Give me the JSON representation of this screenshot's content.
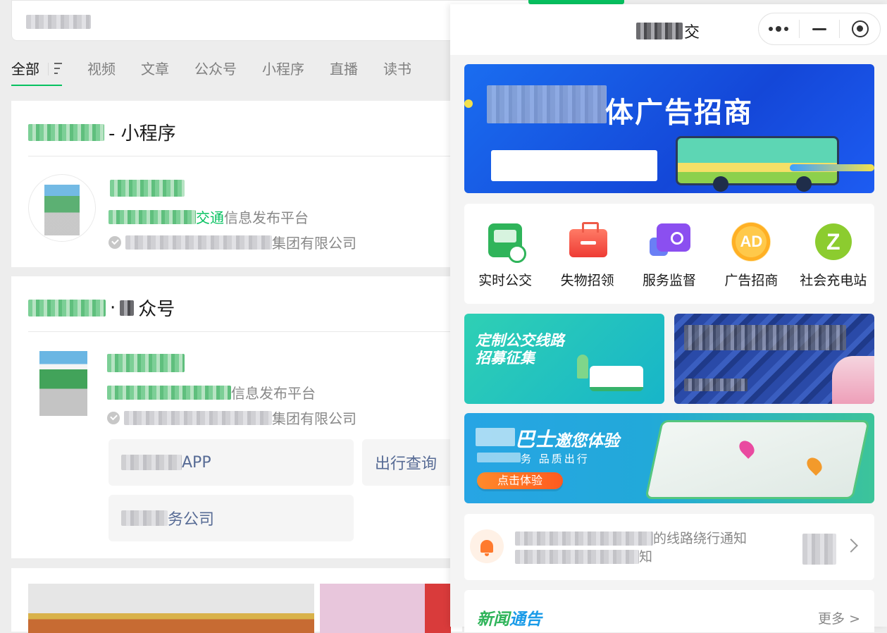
{
  "search": {
    "tabs": [
      "视频",
      "文章",
      "公众号",
      "小程序",
      "直播",
      "读书"
    ],
    "active_tab": "全部"
  },
  "miniprogram_card": {
    "title_suffix": "- 小程序",
    "desc_hl": "交通",
    "desc_rest": "信息发布平台",
    "company_suffix": "集团有限公司"
  },
  "official_account_card": {
    "title_suffix": "众号",
    "desc_rest": "信息发布平台",
    "company_suffix": "集团有限公司",
    "services": [
      {
        "label": "APP"
      },
      {
        "label": "出行查询"
      },
      {
        "label": "务公司"
      }
    ]
  },
  "mini_program": {
    "title_suffix": "交",
    "banner": {
      "title": "体广告招商"
    },
    "grid": [
      {
        "icon": "bus-icon",
        "label": "实时公交"
      },
      {
        "icon": "lost-found-icon",
        "label": "失物招领"
      },
      {
        "icon": "service-supervision-icon",
        "label": "服务监督"
      },
      {
        "icon": "ad-icon",
        "label": "广告招商"
      },
      {
        "icon": "charging-station-icon",
        "label": "社会充电站"
      }
    ],
    "custom_bus_banner": {
      "line1": "定制公交线路",
      "line2": "招募征集"
    },
    "bus_banner": {
      "name": "巴士",
      "invite": "邀您体验",
      "sub": "务  品质出行",
      "button": "点击体验",
      "ad_text": "AD"
    },
    "charging_letter": "Z",
    "notice": {
      "line1": "的线路绕行通知",
      "line2": "知"
    },
    "news": {
      "title_a": "新闻",
      "title_b": "通告",
      "more": "更多 >"
    }
  }
}
